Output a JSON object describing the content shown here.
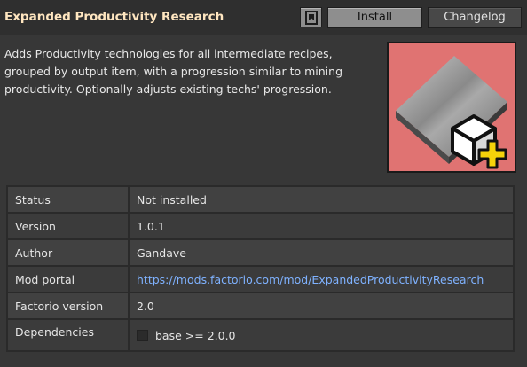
{
  "header": {
    "title": "Expanded Productivity Research",
    "install_label": "Install",
    "changelog_label": "Changelog",
    "bookmark_icon": "bookmark-icon"
  },
  "description": "Adds Productivity technologies for all intermediate recipes, grouped by output item, with a progression similar to mining productivity. Optionally adjusts existing techs' progression.",
  "thumbnail": {
    "icon": "steel-plate-with-productivity-module-icon",
    "background_color": "#e07372"
  },
  "info": {
    "status_label": "Status",
    "status_value": "Not installed",
    "version_label": "Version",
    "version_value": "1.0.1",
    "author_label": "Author",
    "author_value": "Gandave",
    "portal_label": "Mod portal",
    "portal_value": "https://mods.factorio.com/mod/ExpandedProductivityResearch",
    "factorio_label": "Factorio version",
    "factorio_value": "2.0",
    "deps_label": "Dependencies",
    "deps_items": [
      "base >= 2.0.0"
    ]
  },
  "colors": {
    "title": "#ffe6c0",
    "link": "#7fb2ff",
    "panel": "#373737"
  }
}
